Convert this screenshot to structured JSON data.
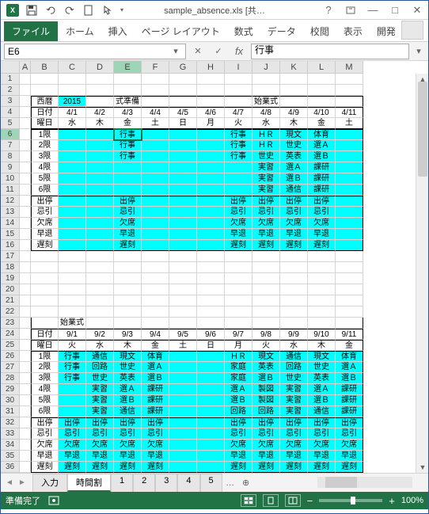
{
  "window": {
    "title": "sample_absence.xls [共…"
  },
  "ribbon": {
    "file": "ファイル",
    "tabs": [
      "ホーム",
      "挿入",
      "ページ レイアウト",
      "数式",
      "データ",
      "校閲",
      "表示",
      "開発"
    ]
  },
  "namebox": {
    "ref": "E6"
  },
  "formula": {
    "value": "行事"
  },
  "cols": [
    "A",
    "B",
    "C",
    "D",
    "E",
    "F",
    "G",
    "H",
    "I",
    "J",
    "K",
    "L",
    "M"
  ],
  "rows1": [
    1,
    2,
    3,
    4,
    5,
    6,
    7,
    8,
    9,
    10,
    11,
    12,
    13,
    14,
    15,
    16,
    17,
    18,
    19,
    20,
    21,
    22,
    23,
    24,
    25,
    26,
    27,
    28,
    29,
    30,
    31,
    32,
    33,
    34,
    35,
    36
  ],
  "block1": {
    "r3": {
      "B": "西暦",
      "C": "2015",
      "E": "式準備",
      "J": "始業式"
    },
    "r4": {
      "B": "日付",
      "C": "4/1",
      "D": "4/2",
      "E": "4/3",
      "F": "4/4",
      "G": "4/5",
      "H": "4/6",
      "I": "4/7",
      "J": "4/8",
      "K": "4/9",
      "L": "4/10",
      "M": "4/11"
    },
    "r5": {
      "B": "曜日",
      "C": "水",
      "D": "木",
      "E": "金",
      "F": "土",
      "G": "日",
      "H": "月",
      "I": "火",
      "J": "水",
      "K": "木",
      "L": "金",
      "M": "土"
    },
    "r6": {
      "B": "1限",
      "E": "行事",
      "I": "行事",
      "J": "ＨＲ",
      "K": "現文",
      "L": "体育"
    },
    "r7": {
      "B": "2限",
      "E": "行事",
      "I": "行事",
      "J": "ＨＲ",
      "K": "世史",
      "L": "選Ａ"
    },
    "r8": {
      "B": "3限",
      "E": "行事",
      "I": "行事",
      "J": "世史",
      "K": "英表",
      "L": "選Ｂ"
    },
    "r9": {
      "B": "4限",
      "J": "実習",
      "K": "選Ａ",
      "L": "課研"
    },
    "r10": {
      "B": "5限",
      "J": "実習",
      "K": "選Ｂ",
      "L": "課研"
    },
    "r11": {
      "B": "6限",
      "J": "実習",
      "K": "通信",
      "L": "課研"
    },
    "r12": {
      "B": "出停",
      "E": "出停",
      "I": "出停",
      "J": "出停",
      "K": "出停",
      "L": "出停"
    },
    "r13": {
      "B": "忌引",
      "E": "忌引",
      "I": "忌引",
      "J": "忌引",
      "K": "忌引",
      "L": "忌引"
    },
    "r14": {
      "B": "欠席",
      "E": "欠席",
      "I": "欠席",
      "J": "欠席",
      "K": "欠席",
      "L": "欠席"
    },
    "r15": {
      "B": "早退",
      "E": "早退",
      "I": "早退",
      "J": "早退",
      "K": "早退",
      "L": "早退"
    },
    "r16": {
      "B": "遅刻",
      "E": "遅刻",
      "I": "遅刻",
      "J": "遅刻",
      "K": "遅刻",
      "L": "遅刻"
    }
  },
  "block2": {
    "r23": {
      "C": "始業式"
    },
    "r24": {
      "B": "日付",
      "C": "9/1",
      "D": "9/2",
      "E": "9/3",
      "F": "9/4",
      "G": "9/5",
      "H": "9/6",
      "I": "9/7",
      "J": "9/8",
      "K": "9/9",
      "L": "9/10",
      "M": "9/11"
    },
    "r25": {
      "B": "曜日",
      "C": "火",
      "D": "水",
      "E": "木",
      "F": "金",
      "G": "土",
      "H": "日",
      "I": "月",
      "J": "火",
      "K": "水",
      "L": "木",
      "M": "金"
    },
    "r26": {
      "B": "1限",
      "C": "行事",
      "D": "通信",
      "E": "現文",
      "F": "体育",
      "I": "ＨＲ",
      "J": "現文",
      "K": "通信",
      "L": "現文",
      "M": "体育"
    },
    "r27": {
      "B": "2限",
      "C": "行事",
      "D": "回路",
      "E": "世史",
      "F": "選Ａ",
      "I": "家庭",
      "J": "英表",
      "K": "回路",
      "L": "世史",
      "M": "選Ａ"
    },
    "r28": {
      "B": "3限",
      "C": "行事",
      "D": "世史",
      "E": "英表",
      "F": "選Ｂ",
      "I": "家庭",
      "J": "選Ｂ",
      "K": "世史",
      "L": "英表",
      "M": "選Ｂ"
    },
    "r29": {
      "B": "4限",
      "D": "実習",
      "E": "選Ａ",
      "F": "課研",
      "I": "選Ａ",
      "J": "製図",
      "K": "実習",
      "L": "選Ａ",
      "M": "課研"
    },
    "r30": {
      "B": "5限",
      "D": "実習",
      "E": "選Ｂ",
      "F": "課研",
      "I": "選Ｂ",
      "J": "製図",
      "K": "実習",
      "L": "選Ｂ",
      "M": "課研"
    },
    "r31": {
      "B": "6限",
      "D": "実習",
      "E": "通信",
      "F": "課研",
      "I": "回路",
      "J": "回路",
      "K": "実習",
      "L": "通信",
      "M": "課研"
    },
    "r32": {
      "B": "出停",
      "C": "出停",
      "D": "出停",
      "E": "出停",
      "F": "出停",
      "I": "出停",
      "J": "出停",
      "K": "出停",
      "L": "出停",
      "M": "出停"
    },
    "r33": {
      "B": "忌引",
      "C": "忌引",
      "D": "忌引",
      "E": "忌引",
      "F": "忌引",
      "I": "忌引",
      "J": "忌引",
      "K": "忌引",
      "L": "忌引",
      "M": "忌引"
    },
    "r34": {
      "B": "欠席",
      "C": "欠席",
      "D": "欠席",
      "E": "欠席",
      "F": "欠席",
      "I": "欠席",
      "J": "欠席",
      "K": "欠席",
      "L": "欠席",
      "M": "欠席"
    },
    "r35": {
      "B": "早退",
      "C": "早退",
      "D": "早退",
      "E": "早退",
      "F": "早退",
      "I": "早退",
      "J": "早退",
      "K": "早退",
      "L": "早退",
      "M": "早退"
    },
    "r36": {
      "B": "遅刻",
      "C": "遅刻",
      "D": "遅刻",
      "E": "遅刻",
      "F": "遅刻",
      "I": "遅刻",
      "J": "遅刻",
      "K": "遅刻",
      "L": "遅刻",
      "M": "遅刻"
    }
  },
  "sheets": {
    "tabs": [
      "入力",
      "時間割",
      "1",
      "2",
      "3",
      "4",
      "5"
    ],
    "active": 1,
    "more": "…"
  },
  "status": {
    "ready": "準備完了",
    "zoom": "100%"
  }
}
